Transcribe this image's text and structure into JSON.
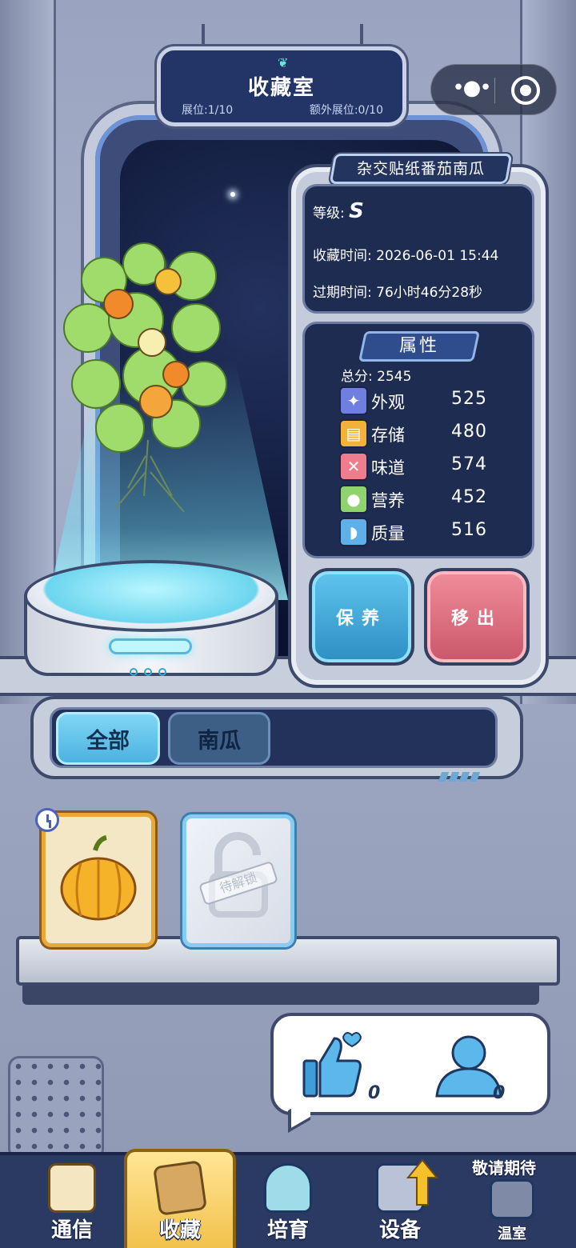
{
  "header": {
    "title": "收藏室",
    "slots": "展位:1/10",
    "extra_slots": "额外展位:0/10"
  },
  "capsule": {
    "menu_icon": "more-dots-icon",
    "close_icon": "record-close-icon"
  },
  "item": {
    "name": "杂交贴纸番茄南瓜",
    "grade_label": "等级:",
    "grade": "S",
    "collect_time_label": "收藏时间:",
    "collect_time": "2026-06-01 15:44",
    "expire_label": "过期时间:",
    "expire_time": "76小时46分28秒"
  },
  "attributes": {
    "title": "属性",
    "total_label": "总分:",
    "total": "2545",
    "list": [
      {
        "name": "外观",
        "value": "525",
        "icon": "sparkle-icon",
        "color": "#6f7fe0"
      },
      {
        "name": "存储",
        "value": "480",
        "icon": "box-icon",
        "color": "#f2b23a"
      },
      {
        "name": "味道",
        "value": "574",
        "icon": "utensils-icon",
        "color": "#ef7d8c"
      },
      {
        "name": "营养",
        "value": "452",
        "icon": "fruit-icon",
        "color": "#8fd36e"
      },
      {
        "name": "质量",
        "value": "516",
        "icon": "muscle-icon",
        "color": "#5fb0e6"
      }
    ]
  },
  "actions": {
    "keep": "保养",
    "remove": "移出"
  },
  "tabs": [
    {
      "label": "全部",
      "active": true
    },
    {
      "label": "南瓜",
      "active": false
    }
  ],
  "cards": [
    {
      "type": "pumpkin",
      "icon": "pumpkin-icon",
      "timer_icon": "clock-icon"
    },
    {
      "type": "locked",
      "icon": "padlock-icon",
      "text": "待解锁"
    }
  ],
  "social": {
    "likes": "0",
    "visitors": "0"
  },
  "nav": [
    {
      "label": "通信",
      "icon": "clipboard-icon"
    },
    {
      "label": "收藏",
      "icon": "collection-box-icon",
      "active": true
    },
    {
      "label": "培育",
      "icon": "sprout-jar-icon"
    },
    {
      "label": "设备",
      "icon": "machine-upgrade-icon"
    },
    {
      "label": "温室",
      "icon": "locked-greenhouse-icon",
      "badge": "敬请期待"
    }
  ],
  "colors": {
    "accent": "#4cb2e0",
    "panel": "#1f2c52",
    "nav_active": "#f2c14c",
    "remove": "#c9566a"
  }
}
